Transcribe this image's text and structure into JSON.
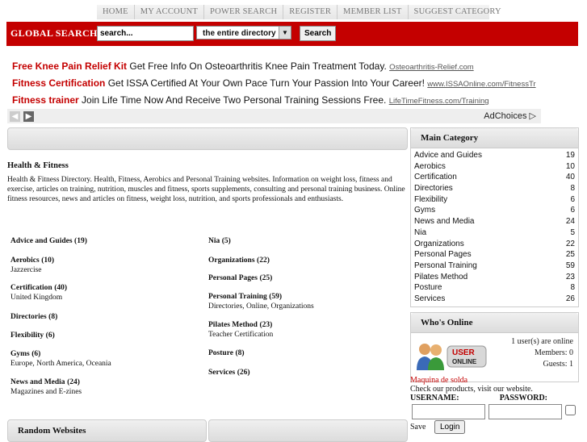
{
  "nav": {
    "items": [
      "HOME",
      "MY ACCOUNT",
      "POWER SEARCH",
      "REGISTER",
      "MEMBER LIST",
      "SUGGEST CATEGORY"
    ]
  },
  "search": {
    "label": "GLOBAL SEARCH",
    "value": "search...",
    "scope": "the entire directory",
    "button": "Search"
  },
  "ads": [
    {
      "title": "Free Knee Pain Relief Kit",
      "text": "Get Free Info On Osteoarthritis Knee Pain Treatment Today.",
      "url": "Osteoarthritis-Relief.com"
    },
    {
      "title": "Fitness Certification",
      "text": "Get ISSA Certified At Your Own Pace Turn Your Passion Into Your Career!",
      "url": "www.ISSAOnline.com/FitnessTr"
    },
    {
      "title": "Fitness trainer",
      "text": "Join Life Time Now And Receive Two Personal Training Sessions Free.",
      "url": "LifeTimeFitness.com/Training"
    }
  ],
  "adchoices": "AdChoices",
  "main": {
    "title": "Health & Fitness",
    "description": "Health & Fitness Directory. Health, Fitness, Aerobics and Personal Training websites. Information on weight loss, fitness and exercise, articles on training, nutrition, muscles and fitness, sports supplements, consulting and personal training business. Online fitness resources, news and articles on fitness, weight loss, nutrition, and sports professionals and enthusiasts."
  },
  "categories_left": [
    {
      "name": "Advice and Guides",
      "count": "(19)",
      "sub": ""
    },
    {
      "name": "Aerobics",
      "count": "(10)",
      "sub": "Jazzercise"
    },
    {
      "name": "Certification",
      "count": "(40)",
      "sub": "United Kingdom"
    },
    {
      "name": "Directories",
      "count": "(8)",
      "sub": ""
    },
    {
      "name": "Flexibility",
      "count": "(6)",
      "sub": ""
    },
    {
      "name": "Gyms",
      "count": "(6)",
      "sub": "Europe, North America, Oceania"
    },
    {
      "name": "News and Media",
      "count": "(24)",
      "sub": "Magazines and E-zines"
    }
  ],
  "categories_right": [
    {
      "name": "Nia",
      "count": "(5)",
      "sub": ""
    },
    {
      "name": "Organizations",
      "count": "(22)",
      "sub": ""
    },
    {
      "name": "Personal Pages",
      "count": "(25)",
      "sub": ""
    },
    {
      "name": "Personal Training",
      "count": "(59)",
      "sub": "Directories, Online, Organizations"
    },
    {
      "name": "Pilates Method",
      "count": "(23)",
      "sub": "Teacher Certification"
    },
    {
      "name": "Posture",
      "count": "(8)",
      "sub": ""
    },
    {
      "name": "Services",
      "count": "(26)",
      "sub": ""
    }
  ],
  "bottom": {
    "random": "Random Websites"
  },
  "sidebar": {
    "main_category_title": "Main Category",
    "categories": [
      {
        "name": "Advice and Guides",
        "count": "19"
      },
      {
        "name": "Aerobics",
        "count": "10"
      },
      {
        "name": "Certification",
        "count": "40"
      },
      {
        "name": "Directories",
        "count": "8"
      },
      {
        "name": "Flexibility",
        "count": "6"
      },
      {
        "name": "Gyms",
        "count": "6"
      },
      {
        "name": "News and Media",
        "count": "24"
      },
      {
        "name": "Nia",
        "count": "5"
      },
      {
        "name": "Organizations",
        "count": "22"
      },
      {
        "name": "Personal Pages",
        "count": "25"
      },
      {
        "name": "Personal Training",
        "count": "59"
      },
      {
        "name": "Pilates Method",
        "count": "23"
      },
      {
        "name": "Posture",
        "count": "8"
      },
      {
        "name": "Services",
        "count": "26"
      }
    ],
    "whos_online_title": "Who's Online",
    "online_line1": "1 user(s) are online",
    "online_line2": "Members: 0",
    "online_line3": "Guests: 1",
    "user_badge_top": "USER",
    "user_badge_bottom": "ONLINE",
    "link_red": "Maquina de solda",
    "link_text": "Check our products, visit our website.",
    "username_label": "USERNAME:",
    "password_label": "PASSWORD:",
    "save_label": "Save",
    "login_button": "Login"
  },
  "colors": {
    "accent": "#c40000",
    "panel": "#e4e4e4"
  }
}
